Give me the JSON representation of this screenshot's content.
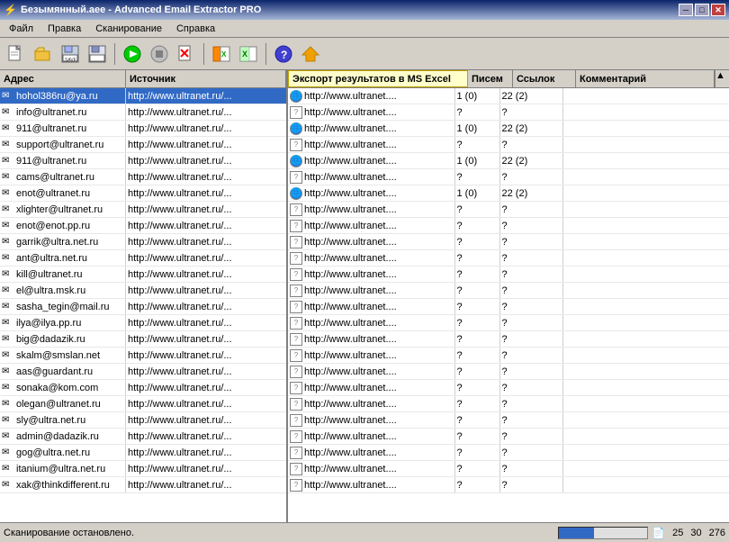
{
  "window": {
    "title": "Безымянный.аее - Advanced Email Extractor PRO",
    "title_icon": "⚡"
  },
  "titlebar": {
    "minimize": "─",
    "maximize": "□",
    "close": "✕"
  },
  "menu": {
    "items": [
      "Файл",
      "Правка",
      "Сканирование",
      "Справка"
    ]
  },
  "toolbar": {
    "buttons": [
      {
        "name": "new",
        "icon": "new-doc-icon",
        "label": ""
      },
      {
        "name": "open",
        "icon": "open-icon",
        "label": ""
      },
      {
        "name": "save-as",
        "icon": "save-as-icon",
        "label": ""
      },
      {
        "name": "save",
        "icon": "save-icon",
        "label": ""
      },
      {
        "name": "play",
        "icon": "play-icon",
        "label": ""
      },
      {
        "name": "stop",
        "icon": "stop-icon",
        "label": ""
      },
      {
        "name": "delete",
        "icon": "delete-icon",
        "label": ""
      },
      {
        "name": "export",
        "icon": "export-icon",
        "label": ""
      },
      {
        "name": "excel",
        "icon": "excel-icon",
        "label": ""
      },
      {
        "name": "help",
        "icon": "help-icon",
        "label": ""
      },
      {
        "name": "home",
        "icon": "home-icon",
        "label": ""
      }
    ]
  },
  "left_panel": {
    "headers": [
      "Адрес",
      "Источник"
    ],
    "rows": [
      {
        "addr": "hohol386ru@ya.ru",
        "src": "http://www.ultranet.ru/..."
      },
      {
        "addr": "info@ultranet.ru",
        "src": "http://www.ultranet.ru/..."
      },
      {
        "addr": "911@ultranet.ru",
        "src": "http://www.ultranet.ru/..."
      },
      {
        "addr": "support@ultranet.ru",
        "src": "http://www.ultranet.ru/..."
      },
      {
        "addr": "911@ultranet.ru",
        "src": "http://www.ultranet.ru/..."
      },
      {
        "addr": "cams@ultranet.ru",
        "src": "http://www.ultranet.ru/..."
      },
      {
        "addr": "enot@ultranet.ru",
        "src": "http://www.ultranet.ru/..."
      },
      {
        "addr": "xlighter@ultranet.ru",
        "src": "http://www.ultranet.ru/..."
      },
      {
        "addr": "enot@enot.pp.ru",
        "src": "http://www.ultranet.ru/..."
      },
      {
        "addr": "garrik@ultra.net.ru",
        "src": "http://www.ultranet.ru/..."
      },
      {
        "addr": "ant@ultra.net.ru",
        "src": "http://www.ultranet.ru/..."
      },
      {
        "addr": "kill@ultranet.ru",
        "src": "http://www.ultranet.ru/..."
      },
      {
        "addr": "el@ultra.msk.ru",
        "src": "http://www.ultranet.ru/..."
      },
      {
        "addr": "sasha_tegin@mail.ru",
        "src": "http://www.ultranet.ru/..."
      },
      {
        "addr": "ilya@ilya.pp.ru",
        "src": "http://www.ultranet.ru/..."
      },
      {
        "addr": "big@dadazik.ru",
        "src": "http://www.ultranet.ru/..."
      },
      {
        "addr": "skalm@smslan.net",
        "src": "http://www.ultranet.ru/..."
      },
      {
        "addr": "aas@guardant.ru",
        "src": "http://www.ultranet.ru/..."
      },
      {
        "addr": "sonaka@kom.com",
        "src": "http://www.ultranet.ru/..."
      },
      {
        "addr": "olegan@ultranet.ru",
        "src": "http://www.ultranet.ru/..."
      },
      {
        "addr": "sly@ultra.net.ru",
        "src": "http://www.ultranet.ru/..."
      },
      {
        "addr": "admin@dadazik.ru",
        "src": "http://www.ultranet.ru/..."
      },
      {
        "addr": "gog@ultra.net.ru",
        "src": "http://www.ultranet.ru/..."
      },
      {
        "addr": "itanium@ultra.net.ru",
        "src": "http://www.ultranet.ru/..."
      },
      {
        "addr": "xak@thinkdifferent.ru",
        "src": "http://www.ultranet.ru/..."
      }
    ]
  },
  "right_panel": {
    "header_export": "Экспорт результатов в MS Excel",
    "headers": [
      "",
      "Писем",
      "Ссылок",
      "Комментарий"
    ],
    "rows": [
      {
        "type": "globe",
        "src": "http://www.ultranet....",
        "emails": "1 (0)",
        "links": "22 (2)",
        "comment": ""
      },
      {
        "type": "question",
        "src": "http://www.ultranet....",
        "emails": "?",
        "links": "?",
        "comment": ""
      },
      {
        "type": "globe",
        "src": "http://www.ultranet....",
        "emails": "1 (0)",
        "links": "22 (2)",
        "comment": ""
      },
      {
        "type": "question",
        "src": "http://www.ultranet....",
        "emails": "?",
        "links": "?",
        "comment": ""
      },
      {
        "type": "globe",
        "src": "http://www.ultranet....",
        "emails": "1 (0)",
        "links": "22 (2)",
        "comment": ""
      },
      {
        "type": "question",
        "src": "http://www.ultranet....",
        "emails": "?",
        "links": "?",
        "comment": ""
      },
      {
        "type": "globe",
        "src": "http://www.ultranet....",
        "emails": "1 (0)",
        "links": "22 (2)",
        "comment": ""
      },
      {
        "type": "question",
        "src": "http://www.ultranet....",
        "emails": "?",
        "links": "?",
        "comment": ""
      },
      {
        "type": "question",
        "src": "http://www.ultranet....",
        "emails": "?",
        "links": "?",
        "comment": ""
      },
      {
        "type": "question",
        "src": "http://www.ultranet....",
        "emails": "?",
        "links": "?",
        "comment": ""
      },
      {
        "type": "question",
        "src": "http://www.ultranet....",
        "emails": "?",
        "links": "?",
        "comment": ""
      },
      {
        "type": "question",
        "src": "http://www.ultranet....",
        "emails": "?",
        "links": "?",
        "comment": ""
      },
      {
        "type": "question",
        "src": "http://www.ultranet....",
        "emails": "?",
        "links": "?",
        "comment": ""
      },
      {
        "type": "question",
        "src": "http://www.ultranet....",
        "emails": "?",
        "links": "?",
        "comment": ""
      },
      {
        "type": "question",
        "src": "http://www.ultranet....",
        "emails": "?",
        "links": "?",
        "comment": ""
      },
      {
        "type": "question",
        "src": "http://www.ultranet....",
        "emails": "?",
        "links": "?",
        "comment": ""
      },
      {
        "type": "question",
        "src": "http://www.ultranet....",
        "emails": "?",
        "links": "?",
        "comment": ""
      },
      {
        "type": "question",
        "src": "http://www.ultranet....",
        "emails": "?",
        "links": "?",
        "comment": ""
      },
      {
        "type": "question",
        "src": "http://www.ultranet....",
        "emails": "?",
        "links": "?",
        "comment": ""
      },
      {
        "type": "question",
        "src": "http://www.ultranet....",
        "emails": "?",
        "links": "?",
        "comment": ""
      },
      {
        "type": "question",
        "src": "http://www.ultranet....",
        "emails": "?",
        "links": "?",
        "comment": ""
      },
      {
        "type": "question",
        "src": "http://www.ultranet....",
        "emails": "?",
        "links": "?",
        "comment": ""
      },
      {
        "type": "question",
        "src": "http://www.ultranet....",
        "emails": "?",
        "links": "?",
        "comment": ""
      },
      {
        "type": "question",
        "src": "http://www.ultranet....",
        "emails": "?",
        "links": "?",
        "comment": ""
      },
      {
        "type": "question",
        "src": "http://www.ultranet....",
        "emails": "?",
        "links": "?",
        "comment": ""
      }
    ]
  },
  "status_bar": {
    "text": "Сканирование остановлено.",
    "progress": 40,
    "page_icon": "📄",
    "count1": "25",
    "count2": "30",
    "count3": "276"
  }
}
